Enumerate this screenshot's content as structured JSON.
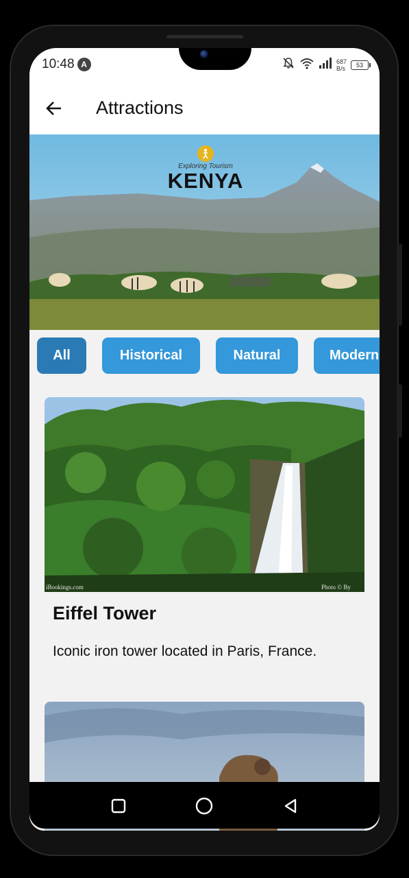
{
  "status_bar": {
    "time": "10:48",
    "app_badge": "A",
    "net_speed_value": "687",
    "net_speed_unit": "B/s",
    "battery": "53"
  },
  "header": {
    "title": "Attractions"
  },
  "banner": {
    "tagline": "Exploring Tourism",
    "country": "KENYA"
  },
  "filters": [
    {
      "label": "All",
      "active": true
    },
    {
      "label": "Historical",
      "active": false
    },
    {
      "label": "Natural",
      "active": false
    },
    {
      "label": "Modern",
      "active": false
    }
  ],
  "cards": [
    {
      "title": "Eiffel Tower",
      "description": "Iconic iron tower located in Paris, France.",
      "watermark_left": "iBookings.com",
      "watermark_right": "Photo © By"
    }
  ],
  "icons": {
    "back": "arrow-left-icon",
    "mute": "bell-off-icon",
    "wifi": "wifi-icon",
    "signal": "signal-icon",
    "battery": "battery-icon",
    "nav_recent": "square-icon",
    "nav_home": "circle-icon",
    "nav_back": "triangle-left-icon"
  },
  "colors": {
    "chip": "#3498db",
    "chip_active": "#2a7bb5",
    "background": "#f2f2f2"
  }
}
